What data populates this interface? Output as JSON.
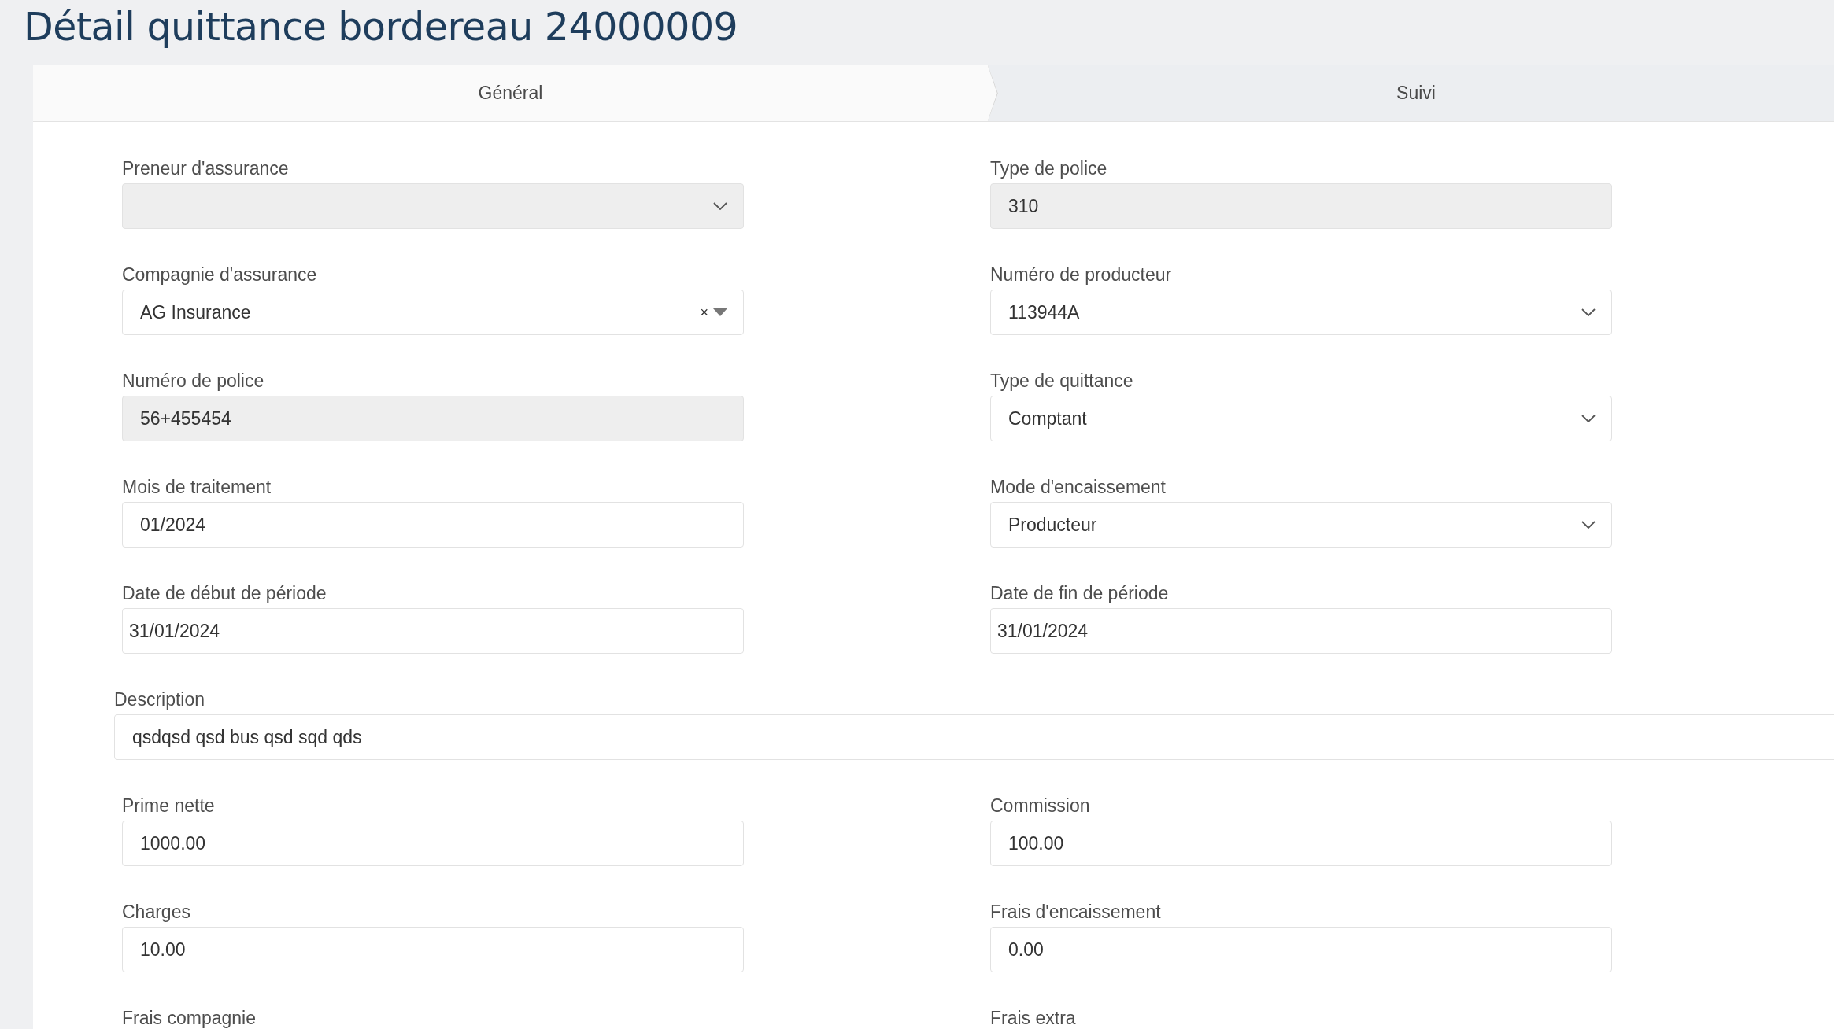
{
  "title": "Détail quittance bordereau 24000009",
  "tabs": [
    {
      "label": "Général",
      "selected": true
    },
    {
      "label": "Suivi",
      "selected": false
    }
  ],
  "rows": [
    [
      {
        "label": "Preneur d'assurance",
        "kind": "select",
        "disabled": true
      },
      {
        "label": "Type de police",
        "kind": "text",
        "value": "310",
        "disabled": true
      }
    ],
    [
      {
        "label": "Compagnie d'assurance",
        "kind": "combo",
        "value": "AG Insurance",
        "clear": "×",
        "disabled": false
      },
      {
        "label": "Numéro de producteur",
        "kind": "select",
        "value": "113944A",
        "disabled": false
      }
    ],
    [
      {
        "label": "Numéro de police",
        "kind": "text",
        "value": "56+455454",
        "disabled": true
      },
      {
        "label": "Type de quittance",
        "kind": "select",
        "value": "Comptant",
        "disabled": false
      }
    ],
    [
      {
        "label": "Mois de traitement",
        "kind": "text",
        "value": "01/2024",
        "disabled": false
      },
      {
        "label": "Mode d'encaissement",
        "kind": "select",
        "value": "Producteur",
        "disabled": false
      }
    ],
    [
      {
        "label": "Date de début de période",
        "kind": "date",
        "value": "31/01/2024",
        "disabled": false
      },
      {
        "label": "Date de fin de période",
        "kind": "date",
        "value": "31/01/2024",
        "disabled": false
      }
    ],
    [
      {
        "label": "Description",
        "kind": "wide",
        "value": "qsdqsd qsd bus qsd sqd qds",
        "disabled": false
      }
    ],
    [
      {
        "label": "Prime nette",
        "kind": "text",
        "value": "1000.00",
        "disabled": false
      },
      {
        "label": "Commission",
        "kind": "text",
        "value": "100.00",
        "disabled": false
      }
    ],
    [
      {
        "label": "Charges",
        "kind": "text",
        "value": "10.00",
        "disabled": false
      },
      {
        "label": "Frais d'encaissement",
        "kind": "text",
        "value": "0.00",
        "disabled": false
      }
    ],
    [
      {
        "label": "Frais compagnie",
        "kind": "text"
      },
      {
        "label": "Frais extra",
        "kind": "text"
      }
    ]
  ]
}
